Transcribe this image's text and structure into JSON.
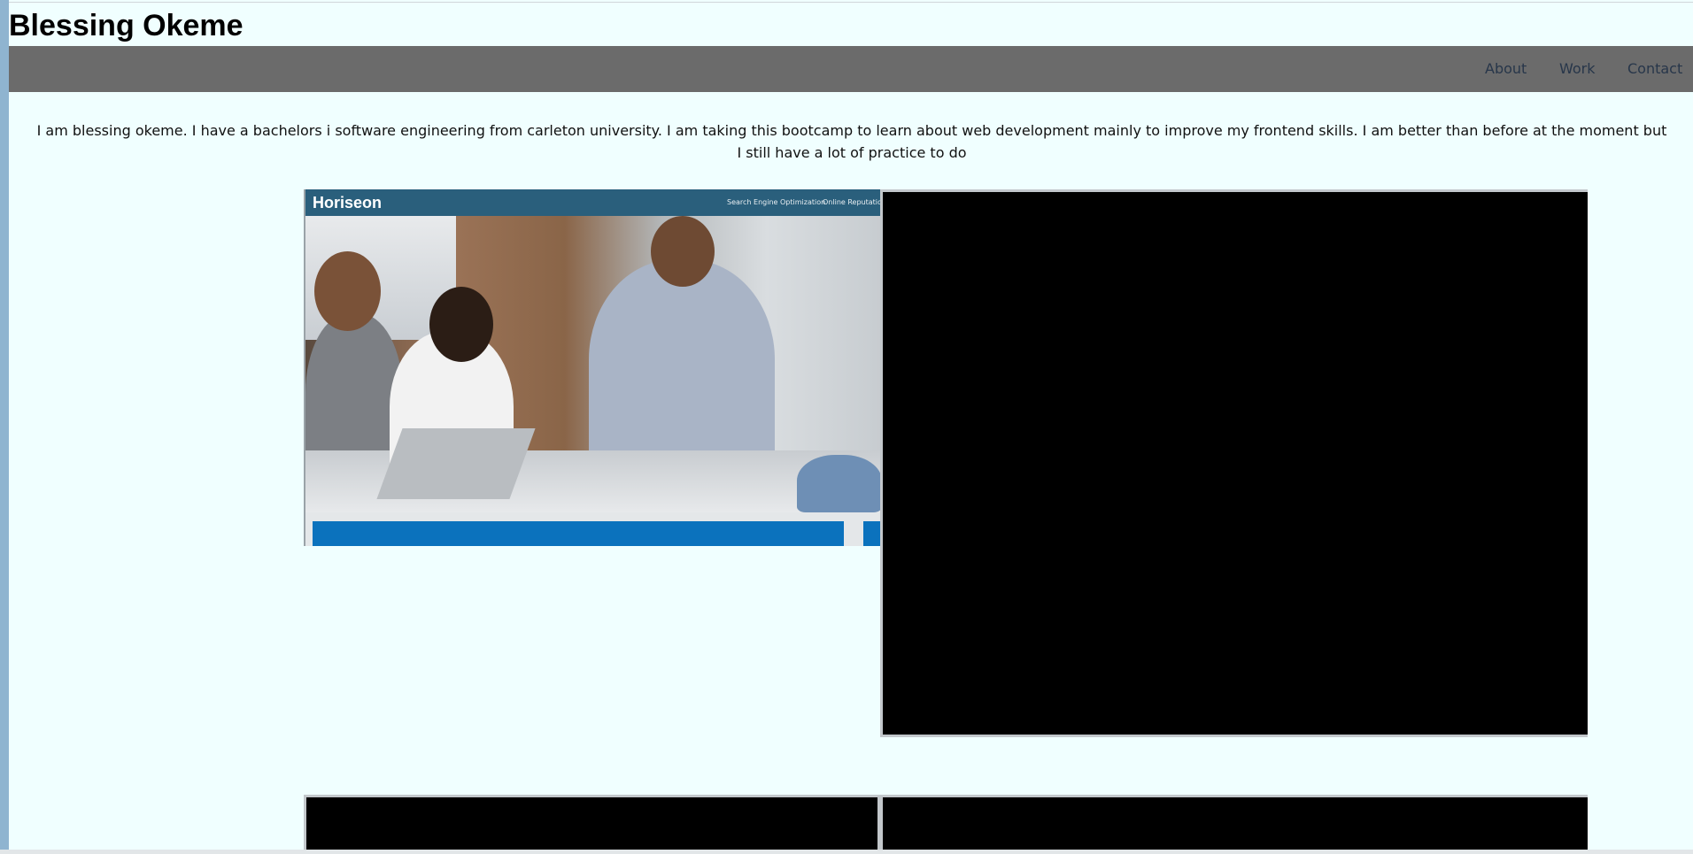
{
  "header": {
    "title": "Blessing Okeme"
  },
  "nav": {
    "items": [
      {
        "label": "About"
      },
      {
        "label": "Work"
      },
      {
        "label": "Contact"
      }
    ]
  },
  "about": {
    "text": "I am blessing okeme. I have a bachelors i software engineering from carleton university. I am taking this bootcamp to learn about web development mainly to improve my frontend skills. I am better than before at the moment but I still have a lot of practice to do"
  },
  "work": {
    "projects": [
      {
        "thumbnail": {
          "logo": "Horiseon",
          "nav": [
            "Search Engine Optimization",
            "Online Reputation"
          ]
        }
      },
      {},
      {},
      {}
    ]
  },
  "colors": {
    "page_background": "#f0ffff",
    "navbar_background": "#6b6b6b",
    "nav_link": "#27364a",
    "placeholder_tile": "#000000",
    "thumbnail_header": "#2a5f7c",
    "thumbnail_card": "#0b72bd"
  },
  "icons": []
}
